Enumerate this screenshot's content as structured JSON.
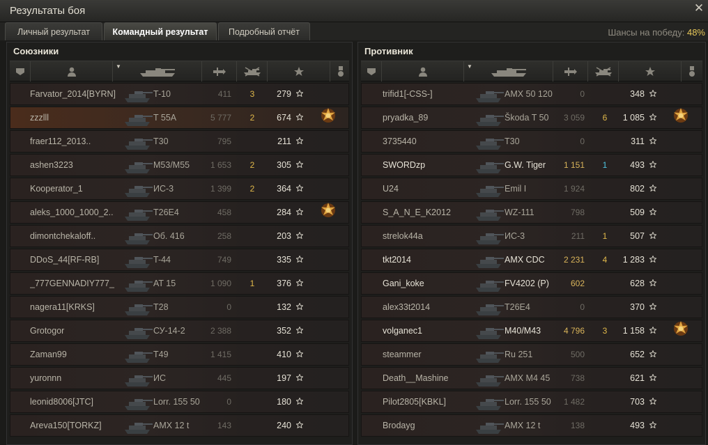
{
  "window": {
    "title": "Результаты боя"
  },
  "tabs": [
    {
      "label": "Личный результат"
    },
    {
      "label": "Командный результат"
    },
    {
      "label": "Подробный отчёт"
    }
  ],
  "odds": {
    "label": "Шансы на победу:",
    "value": "48%"
  },
  "allies": {
    "title": "Союзники",
    "rows": [
      {
        "player": "Farvator_2014[BYRN]",
        "vehicle": "T-10",
        "damage": "411",
        "kills": "3",
        "xp": "279",
        "alive": false,
        "me": false,
        "medal": false
      },
      {
        "player": "zzzlll",
        "vehicle": "T 55A",
        "damage": "5 777",
        "kills": "2",
        "xp": "674",
        "alive": false,
        "me": true,
        "medal": true
      },
      {
        "player": "fraer112_2013..",
        "vehicle": "T30",
        "damage": "795",
        "kills": "",
        "xp": "211",
        "alive": false,
        "me": false,
        "medal": false
      },
      {
        "player": "ashen3223",
        "vehicle": "M53/M55",
        "damage": "1 653",
        "kills": "2",
        "xp": "305",
        "alive": false,
        "me": false,
        "medal": false
      },
      {
        "player": "Kooperator_1",
        "vehicle": "ИС-3",
        "damage": "1 399",
        "kills": "2",
        "xp": "364",
        "alive": false,
        "me": false,
        "medal": false
      },
      {
        "player": "aleks_1000_1000_2..",
        "vehicle": "T26E4",
        "damage": "458",
        "kills": "",
        "xp": "284",
        "alive": false,
        "me": false,
        "medal": true
      },
      {
        "player": "dimontchekaloff..",
        "vehicle": "Об. 416",
        "damage": "258",
        "kills": "",
        "xp": "203",
        "alive": false,
        "me": false,
        "medal": false
      },
      {
        "player": "DDoS_44[RF-RB]",
        "vehicle": "T-44",
        "damage": "749",
        "kills": "",
        "xp": "335",
        "alive": false,
        "me": false,
        "medal": false
      },
      {
        "player": "_777GENNADIY777_",
        "vehicle": "AT 15",
        "damage": "1 090",
        "kills": "1",
        "xp": "376",
        "alive": false,
        "me": false,
        "medal": false
      },
      {
        "player": "nagera11[KRKS]",
        "vehicle": "T28",
        "damage": "0",
        "kills": "",
        "xp": "132",
        "alive": false,
        "me": false,
        "medal": false
      },
      {
        "player": "Grotogor",
        "vehicle": "СУ-14-2",
        "damage": "2 388",
        "kills": "",
        "xp": "352",
        "alive": false,
        "me": false,
        "medal": false
      },
      {
        "player": "Zaman99",
        "vehicle": "T49",
        "damage": "1 415",
        "kills": "",
        "xp": "410",
        "alive": false,
        "me": false,
        "medal": false
      },
      {
        "player": "yuronnn",
        "vehicle": "ИС",
        "damage": "445",
        "kills": "",
        "xp": "197",
        "alive": false,
        "me": false,
        "medal": false
      },
      {
        "player": "leonid8006[JTC]",
        "vehicle": "Lorr. 155 50",
        "damage": "0",
        "kills": "",
        "xp": "180",
        "alive": false,
        "me": false,
        "medal": false
      },
      {
        "player": "Areva150[TORKZ]",
        "vehicle": "AMX 12 t",
        "damage": "143",
        "kills": "",
        "xp": "240",
        "alive": false,
        "me": false,
        "medal": false
      }
    ]
  },
  "enemies": {
    "title": "Противник",
    "rows": [
      {
        "player": "trifid1[-CSS-]",
        "vehicle": "AMX 50 120",
        "damage": "0",
        "kills": "",
        "xp": "348",
        "alive": false,
        "medal": false,
        "hidmg": false,
        "blue": false
      },
      {
        "player": "pryadka_89",
        "vehicle": "Škoda T 50",
        "damage": "3 059",
        "kills": "6",
        "xp": "1 085",
        "alive": false,
        "medal": true,
        "hidmg": false,
        "blue": false
      },
      {
        "player": "3735440",
        "vehicle": "T30",
        "damage": "0",
        "kills": "",
        "xp": "311",
        "alive": false,
        "medal": false,
        "hidmg": false,
        "blue": false
      },
      {
        "player": "SWORDzp",
        "vehicle": "G.W. Tiger",
        "damage": "1 151",
        "kills": "1",
        "xp": "493",
        "alive": true,
        "medal": false,
        "hidmg": true,
        "blue": true
      },
      {
        "player": "U24",
        "vehicle": "Emil I",
        "damage": "1 924",
        "kills": "",
        "xp": "802",
        "alive": false,
        "medal": false,
        "hidmg": false,
        "blue": false
      },
      {
        "player": "S_A_N_E_K2012",
        "vehicle": "WZ-111",
        "damage": "798",
        "kills": "",
        "xp": "509",
        "alive": false,
        "medal": false,
        "hidmg": false,
        "blue": false
      },
      {
        "player": "strelok44a",
        "vehicle": "ИС-3",
        "damage": "211",
        "kills": "1",
        "xp": "507",
        "alive": false,
        "medal": false,
        "hidmg": false,
        "blue": false
      },
      {
        "player": "tkt2014",
        "vehicle": "AMX CDC",
        "damage": "2 231",
        "kills": "4",
        "xp": "1 283",
        "alive": true,
        "medal": false,
        "hidmg": true,
        "blue": false
      },
      {
        "player": "Gani_koke",
        "vehicle": "FV4202 (P)",
        "damage": "602",
        "kills": "",
        "xp": "628",
        "alive": true,
        "medal": false,
        "hidmg": true,
        "blue": false
      },
      {
        "player": "alex33t2014",
        "vehicle": "T26E4",
        "damage": "0",
        "kills": "",
        "xp": "370",
        "alive": false,
        "medal": false,
        "hidmg": false,
        "blue": false
      },
      {
        "player": "volganec1",
        "vehicle": "M40/M43",
        "damage": "4 796",
        "kills": "3",
        "xp": "1 158",
        "alive": true,
        "medal": true,
        "hidmg": true,
        "blue": false
      },
      {
        "player": "steammer",
        "vehicle": "Ru 251",
        "damage": "500",
        "kills": "",
        "xp": "652",
        "alive": false,
        "medal": false,
        "hidmg": false,
        "blue": false
      },
      {
        "player": "Death__Mashine",
        "vehicle": "AMX M4 45",
        "damage": "738",
        "kills": "",
        "xp": "621",
        "alive": false,
        "medal": false,
        "hidmg": false,
        "blue": false
      },
      {
        "player": "Pilot2805[KBKL]",
        "vehicle": "Lorr. 155 50",
        "damage": "1 482",
        "kills": "",
        "xp": "703",
        "alive": false,
        "medal": false,
        "hidmg": false,
        "blue": false
      },
      {
        "player": "Brodayg",
        "vehicle": "AMX 12 t",
        "damage": "138",
        "kills": "",
        "xp": "493",
        "alive": false,
        "medal": false,
        "hidmg": false,
        "blue": false
      }
    ]
  },
  "colors": {
    "accent": "#e8c85a",
    "kills": "#e0b84a",
    "spotted": "#4fc3e0",
    "me_row": "#4a2c1c"
  }
}
